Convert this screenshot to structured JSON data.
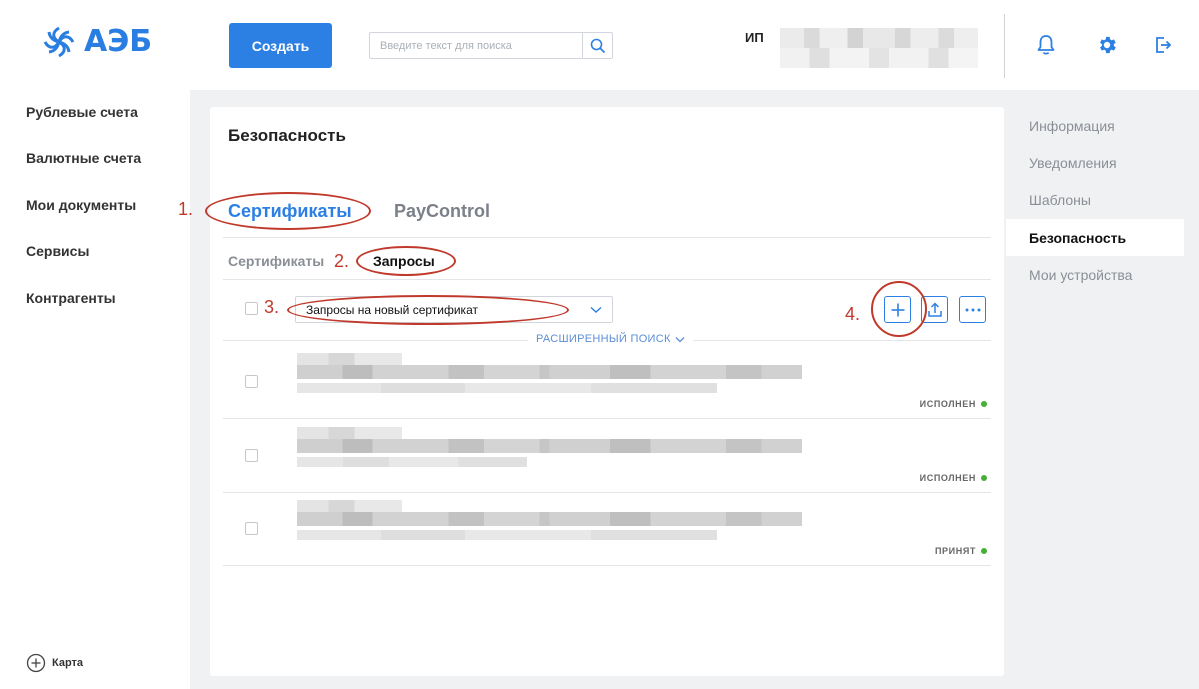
{
  "header": {
    "logo_text": "АЭБ",
    "create_label": "Создать",
    "search_placeholder": "Введите текст для поиска",
    "company_prefix": "ИП",
    "icons": {
      "bell": "bell-icon",
      "settings": "gear-icon",
      "logout": "logout-icon",
      "search": "search-icon"
    }
  },
  "left_nav": {
    "items": [
      {
        "label": "Рублевые счета"
      },
      {
        "label": "Валютные счета"
      },
      {
        "label": "Мои документы"
      },
      {
        "label": "Сервисы"
      },
      {
        "label": "Контрагенты"
      }
    ],
    "card_label": "Карта"
  },
  "main": {
    "title": "Безопасность",
    "tabs": [
      {
        "label": "Сертификаты",
        "active": true
      },
      {
        "label": "PayControl",
        "active": false
      }
    ],
    "subtabs": [
      {
        "label": "Сертификаты",
        "active": false
      },
      {
        "label": "Запросы",
        "active": true
      }
    ],
    "filter_select": {
      "value": "Запросы на новый сертификат"
    },
    "advanced_search_label": "РАСШИРЕННЫЙ ПОИСК",
    "rows": [
      {
        "status": "ИСПОЛНЕН"
      },
      {
        "status": "ИСПОЛНЕН"
      },
      {
        "status": "ПРИНЯТ"
      }
    ],
    "annotations": [
      "1.",
      "2.",
      "3.",
      "4."
    ]
  },
  "right_nav": {
    "items": [
      {
        "label": "Информация"
      },
      {
        "label": "Уведомления"
      },
      {
        "label": "Шаблоны"
      },
      {
        "label": "Безопасность",
        "active": true
      },
      {
        "label": "Мои устройства"
      }
    ]
  },
  "colors": {
    "accent": "#2d80e3",
    "annotation": "#c0392b",
    "status_ok": "#45b035",
    "workspace_bg": "#f0f1f3"
  }
}
